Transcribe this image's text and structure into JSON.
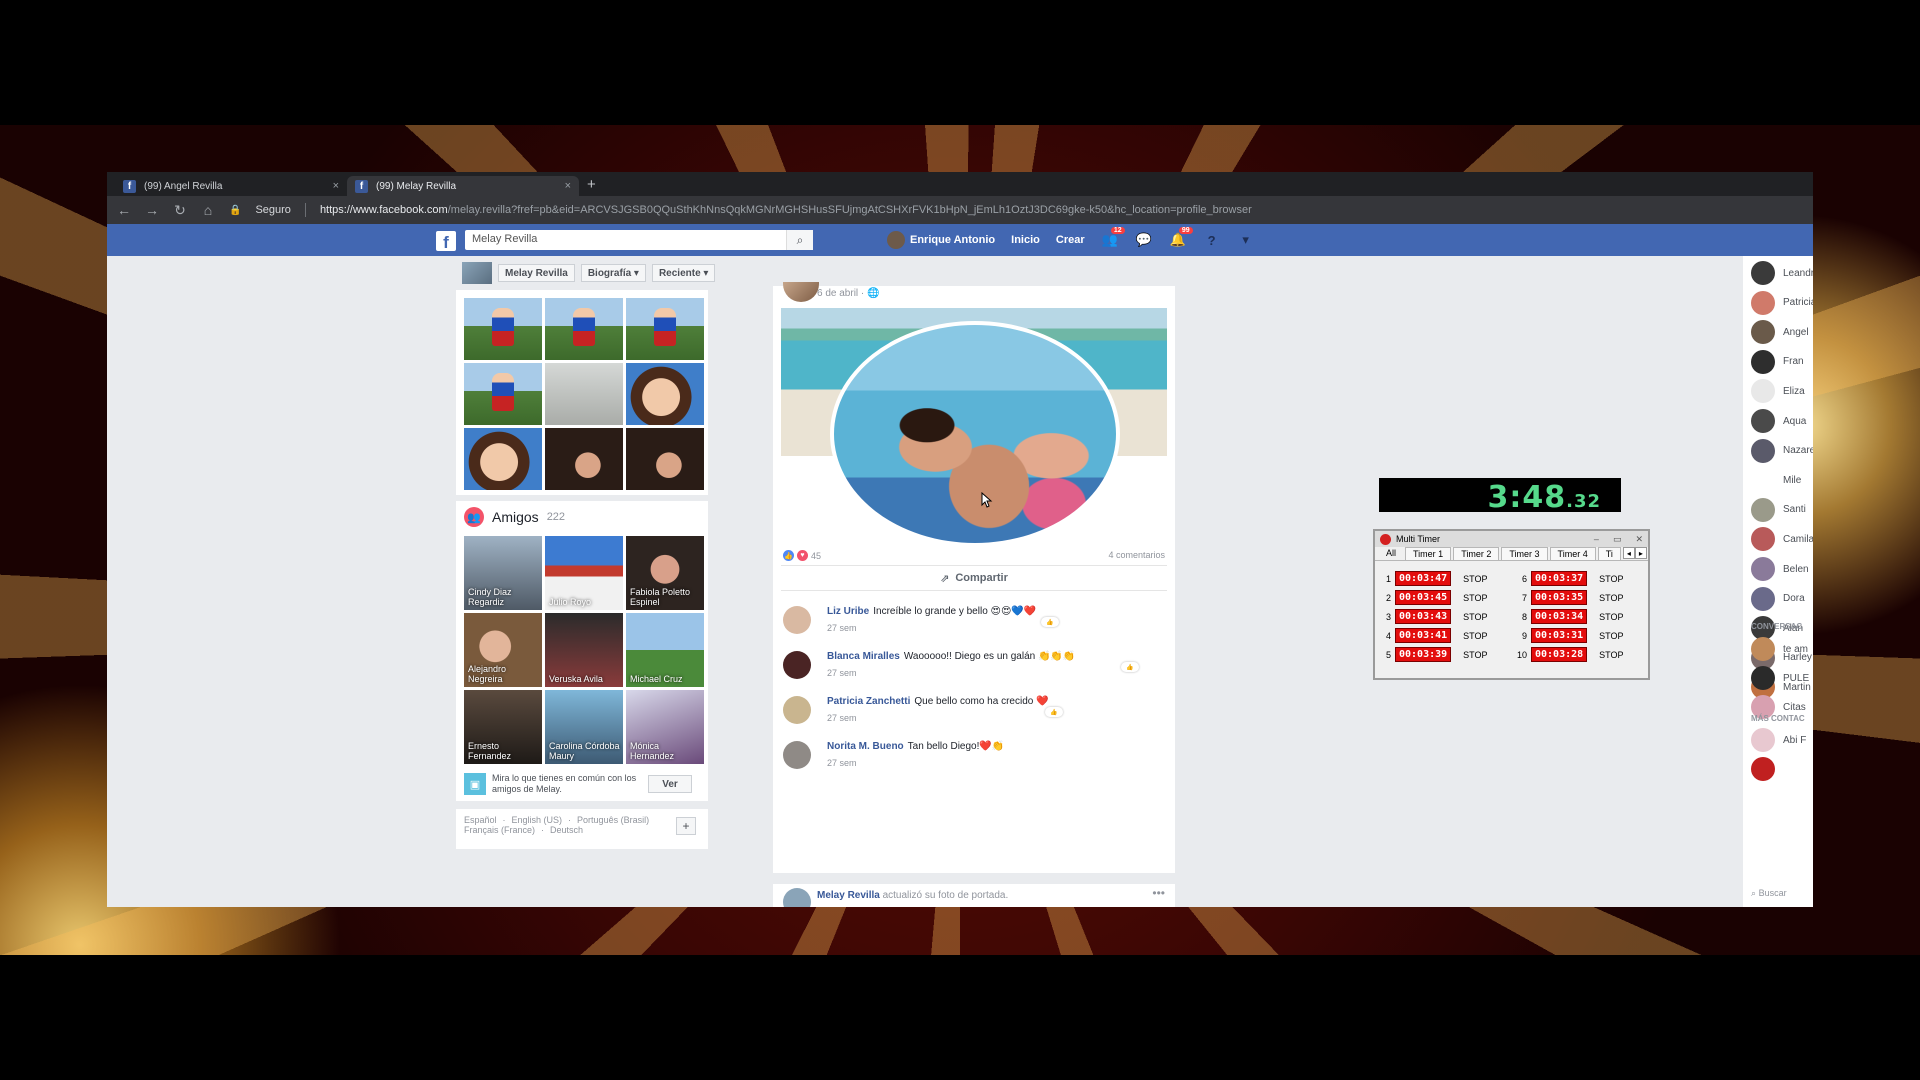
{
  "browser": {
    "tabs": [
      {
        "title": "(99) Angel Revilla",
        "close": "×"
      },
      {
        "title": "(99) Melay Revilla",
        "close": "×"
      }
    ],
    "new_tab": "+",
    "secure_label": "Seguro",
    "url_host": "https://www.facebook.com",
    "url_path": "/melay.revilla?fref=pb&eid=ARCVSJGSB0QQuSthKhNnsQqkMGNrMGHSHusSFUjmgAtCSHXrFVK1bHpN_jEmLh1OztJ3DC69gke-k50&hc_location=profile_browser"
  },
  "facebook": {
    "logo": "f",
    "search_value": "Melay Revilla",
    "user_name": "Enrique Antonio",
    "nav_inicio": "Inicio",
    "nav_crear": "Crear",
    "badge_friends": "12",
    "badge_notifications": "99"
  },
  "profile_subnav": {
    "name": "Melay Revilla",
    "biografia": "Biografía ▾",
    "reciente": "Reciente ▾"
  },
  "friends": {
    "title": "Amigos",
    "count": "222",
    "people": [
      "Cindy Diaz Regardiz",
      "Julio Royo",
      "Fabiola Poletto Espinel",
      "Alejandro Negreira",
      "Veruska Avila",
      "Michael Cruz",
      "Ernesto Fernandez",
      "Carolina Córdoba Maury",
      "Mónica Hernandez"
    ],
    "common_text": "Mira lo que tienes en común con los amigos de Melay.",
    "ver_label": "Ver"
  },
  "languages": {
    "line1": [
      "Español",
      "English (US)",
      "Português (Brasil)"
    ],
    "line2": [
      "Français (France)",
      "Deutsch"
    ],
    "plus": "+"
  },
  "post": {
    "date": "6 de abril",
    "reactions_count": "45",
    "comments_count": "4 comentarios",
    "share_label": "Compartir",
    "comments": [
      {
        "author": "Liz Uribe",
        "text": "Increíble lo grande y bello 😍😍💙❤️",
        "time": "27 sem"
      },
      {
        "author": "Blanca Miralles",
        "text": "Waooooo!! Diego es un galán 👏👏👏",
        "time": "27 sem"
      },
      {
        "author": "Patricia Zanchetti",
        "text": "Que bello como ha crecido ❤️",
        "time": "27 sem"
      },
      {
        "author": "Norita M. Bueno",
        "text": "Tan bello Diego!❤️👏",
        "time": "27 sem"
      }
    ],
    "next_post_author": "Melay Revilla",
    "next_post_text": "actualizó su foto de portada."
  },
  "chat": {
    "contacts": [
      "Leandro",
      "Patricia",
      "Angel",
      "Fran",
      "Eliza",
      "Aqua",
      "Nazareth",
      "Mile",
      "Santi",
      "Camila",
      "Belen",
      "Dora",
      "Alan",
      "Harley",
      "Martin"
    ],
    "section_conversations": "CONVERSAC",
    "conversations": [
      "te am",
      "PULE",
      "Citas"
    ],
    "section_more": "MÁS CONTAC",
    "more_contacts": [
      "Abi F",
      ""
    ],
    "search_placeholder": "Buscar"
  },
  "big_timer": {
    "time": "3:48",
    "fraction": ".32"
  },
  "multi_timer": {
    "title": "Multi Timer",
    "tabs": [
      "All",
      "Timer 1",
      "Timer 2",
      "Timer 3",
      "Timer 4",
      "Ti"
    ],
    "stop_label": "STOP",
    "rows": [
      {
        "left_num": "1",
        "left_time": "00:03:47",
        "right_num": "6",
        "right_time": "00:03:37"
      },
      {
        "left_num": "2",
        "left_time": "00:03:45",
        "right_num": "7",
        "right_time": "00:03:35"
      },
      {
        "left_num": "3",
        "left_time": "00:03:43",
        "right_num": "8",
        "right_time": "00:03:34"
      },
      {
        "left_num": "4",
        "left_time": "00:03:41",
        "right_num": "9",
        "right_time": "00:03:31"
      },
      {
        "left_num": "5",
        "left_time": "00:03:39",
        "right_num": "10",
        "right_time": "00:03:28"
      }
    ]
  },
  "colors": {
    "facebook_blue": "#4267b2",
    "link_blue": "#385898",
    "timer_green": "#56d98b",
    "timer_red": "#e30d0d"
  }
}
